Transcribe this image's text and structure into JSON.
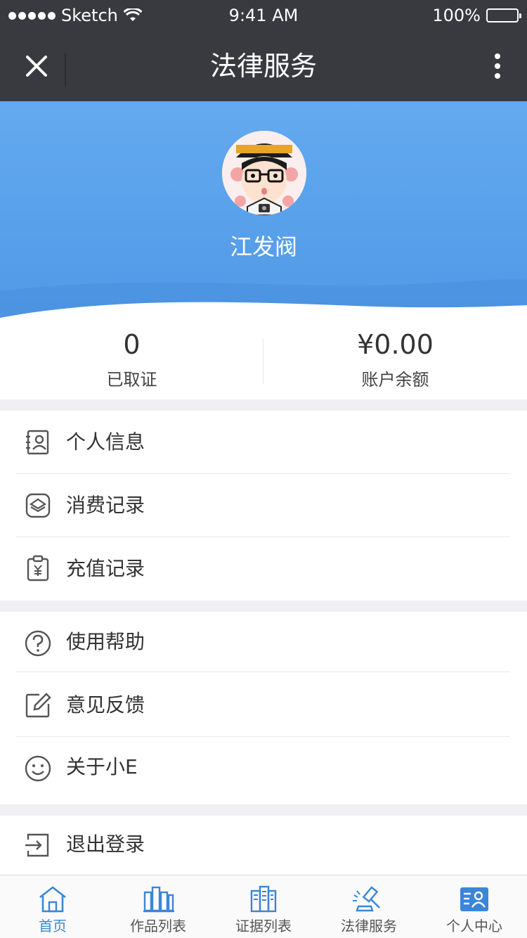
{
  "status_bar": {
    "carrier": "Sketch",
    "time": "9:41 AM",
    "battery": "100%"
  },
  "nav": {
    "title": "法律服务"
  },
  "profile": {
    "name": "江发阀"
  },
  "stats": [
    {
      "value": "0",
      "label": "已取证"
    },
    {
      "value": "¥0.00",
      "label": "账户余额"
    }
  ],
  "menu_group_1": [
    {
      "label": "个人信息",
      "icon": "id-card-icon"
    },
    {
      "label": "消费记录",
      "icon": "consumption-icon"
    },
    {
      "label": "充值记录",
      "icon": "recharge-icon"
    }
  ],
  "menu_group_2": [
    {
      "label": "使用帮助",
      "icon": "question-icon"
    },
    {
      "label": "意见反馈",
      "icon": "edit-icon"
    },
    {
      "label": "关于小E",
      "icon": "smiley-icon"
    }
  ],
  "menu_group_3": [
    {
      "label": "退出登录",
      "icon": "logout-icon"
    }
  ],
  "tabs": [
    {
      "label": "首页",
      "icon": "home-icon",
      "active": true
    },
    {
      "label": "作品列表",
      "icon": "works-icon",
      "active": false
    },
    {
      "label": "证据列表",
      "icon": "evidence-icon",
      "active": false
    },
    {
      "label": "法律服务",
      "icon": "gavel-icon",
      "active": false
    },
    {
      "label": "个人中心",
      "icon": "user-center-icon",
      "active": false
    }
  ],
  "colors": {
    "nav_bg": "#393a3f",
    "hero": "#5ca3ee",
    "accent": "#3a86d8"
  }
}
